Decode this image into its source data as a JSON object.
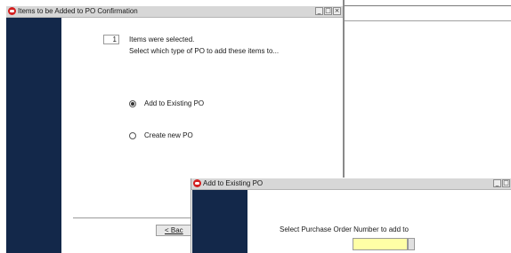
{
  "dialog1": {
    "title": "Items to be Added to PO Confirmation",
    "item_count": "1",
    "items_selected_text": "Items were selected.",
    "instruction": "Select which type of PO to add these items to...",
    "options": [
      {
        "label": "Add to Existing PO",
        "checked": true
      },
      {
        "label": "Create new PO",
        "checked": false
      }
    ],
    "back_label": "< Bac"
  },
  "dialog2": {
    "title": "Add to Existing PO",
    "prompt": "Select Purchase Order Number to add to",
    "po_number_value": ""
  },
  "titlebar_buttons": {
    "minimize": "_",
    "maximize": "□",
    "close": "×"
  },
  "colors": {
    "titlebar": "#d7d7d7",
    "side_panel": "#13284a",
    "input_highlight": "#ffffa6",
    "oracle_logo": "#d31f1f"
  }
}
